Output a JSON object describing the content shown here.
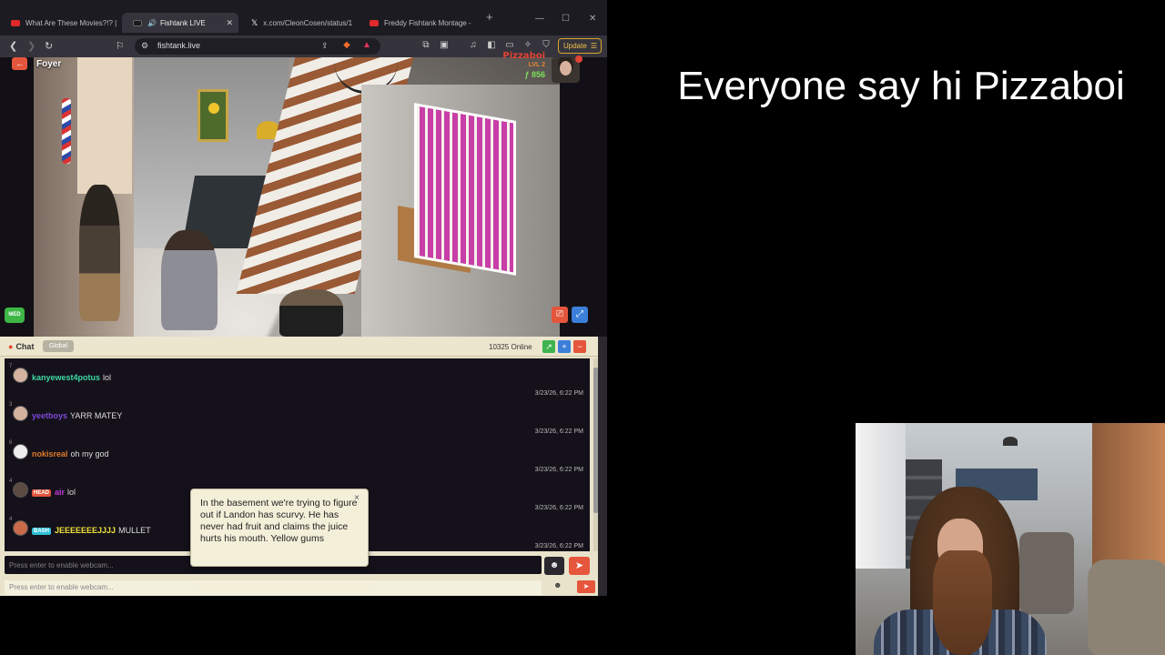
{
  "browser": {
    "tabs": [
      {
        "label": "What Are These Movies?!? |",
        "icon": "youtube-icon"
      },
      {
        "label": "Fishtank LIVE",
        "icon": "fishtank-icon",
        "active": true
      },
      {
        "label": "x.com/CleonCosen/status/1",
        "icon": "x-icon"
      },
      {
        "label": "Freddy Fishtank Montage -",
        "icon": "youtube-icon"
      }
    ],
    "url": "fishtank.live",
    "update_label": "Update"
  },
  "stream": {
    "room_label": "Foyer",
    "user_name": "Pizzaboi",
    "user_level": "LVL 2",
    "user_coins": "856",
    "badge": "MED"
  },
  "chat": {
    "title": "Chat",
    "channel": "Global",
    "online": "10325 Online",
    "messages": [
      {
        "rank": "7",
        "user": "kanyewest4potus",
        "user_color": "#3fd9a6",
        "text": "lol",
        "tag": "",
        "time": "3/23/26, 6:22 PM"
      },
      {
        "rank": "3",
        "user": "yeetboys",
        "user_color": "#7c4ad8",
        "text": "YARR MATEY",
        "tag": "",
        "time": "3/23/26, 6:22 PM"
      },
      {
        "rank": "6",
        "user": "nokisreal",
        "user_color": "#e07b2a",
        "text": "oh my god",
        "tag": "",
        "time": "3/23/26, 6:22 PM"
      },
      {
        "rank": "4",
        "user": "air",
        "user_color": "#c23ad8",
        "text": "lol",
        "tag": "HEAD",
        "tag_bg": "#e0563c",
        "time": "3/23/26, 6:22 PM"
      },
      {
        "rank": "4",
        "user": "JEEEEEEEJJJJ",
        "user_color": "#f2e13b",
        "text": "MULLET",
        "tag": "BASH",
        "tag_bg": "#2ec0d8",
        "time": "3/23/26, 6:22 PM"
      }
    ],
    "input_placeholder": "Press enter to enable webcam..."
  },
  "tooltip": {
    "text": "In the basement we're trying to figure out if Landon has scurvy. He has never had fruit and claims the juice hurts his mouth. Yellow gums"
  },
  "overlay": {
    "heading": "Everyone say hi Pizzaboi"
  }
}
